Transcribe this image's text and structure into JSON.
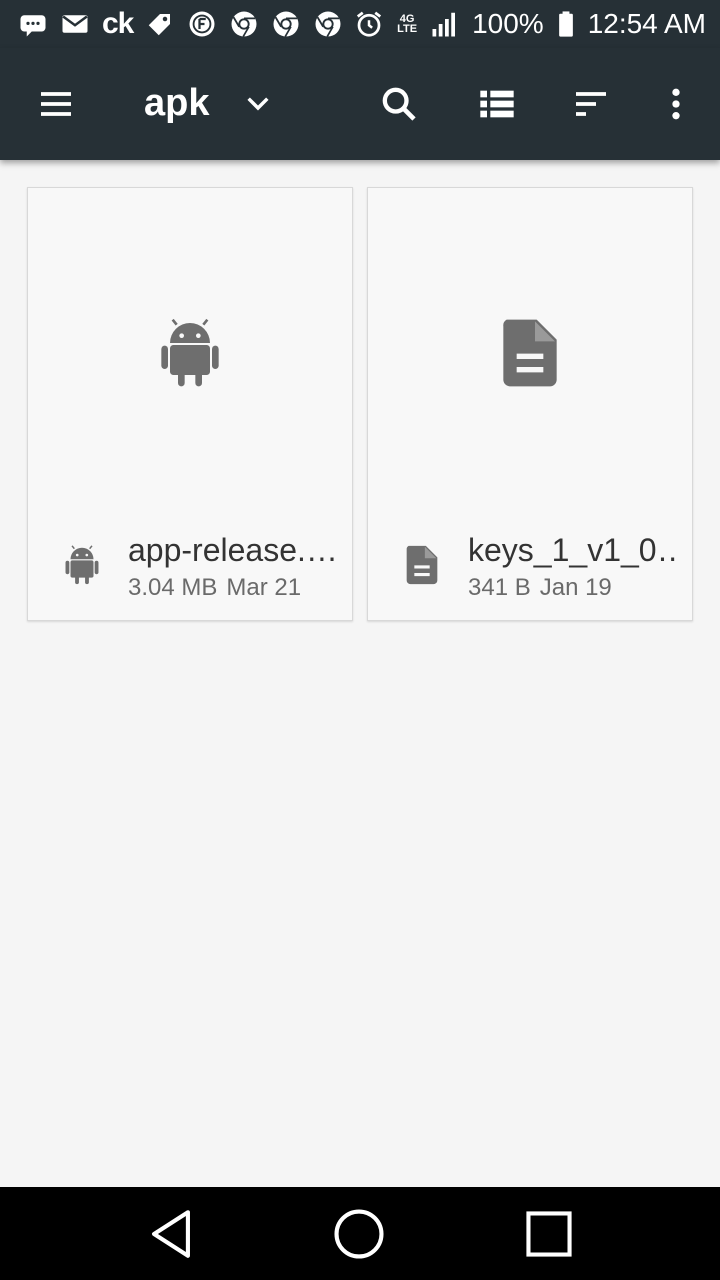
{
  "status_bar": {
    "app_text": "ck",
    "battery": "100%",
    "time": "12:54 AM",
    "network_top": "4G",
    "network_bottom": "LTE",
    "icons": [
      "message-icon",
      "email-icon",
      "tag-icon",
      "circle-f-icon",
      "chrome-icon",
      "chrome-icon",
      "chrome-icon",
      "alarm-icon",
      "signal-icon",
      "battery-icon"
    ]
  },
  "toolbar": {
    "title": "apk",
    "icons": [
      "menu-icon",
      "dropdown-icon",
      "search-icon",
      "list-view-icon",
      "sort-icon",
      "more-vert-icon"
    ]
  },
  "files": [
    {
      "name": "app-release.…",
      "size": "3.04 MB",
      "date": "Mar 21",
      "icon": "android-icon"
    },
    {
      "name": "keys_1_v1_0…",
      "size": "341 B",
      "date": "Jan 19",
      "icon": "document-icon"
    }
  ],
  "nav_bar": {
    "icons": [
      "back-icon",
      "home-icon",
      "recents-icon"
    ]
  },
  "colors": {
    "toolbar": "#263036",
    "icon_gray": "#6e6e6e",
    "background": "#f5f5f5"
  }
}
